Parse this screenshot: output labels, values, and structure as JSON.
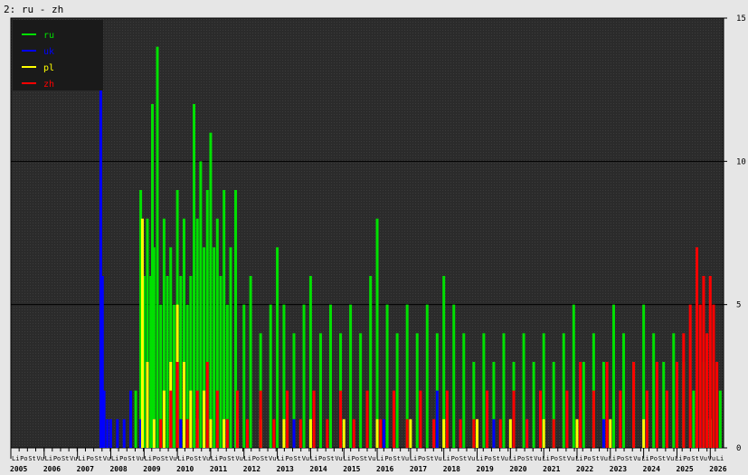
{
  "window_title": "2: ru - zh",
  "colors": {
    "background": "#e6e6e6",
    "plot_background": "#2d2d2d",
    "grid": "#000000",
    "ru": "#00e000",
    "uk": "#0000ff",
    "pl": "#ffff00",
    "zh": "#ff0000"
  },
  "chart_data": {
    "type": "bar",
    "title": "2: ru - zh",
    "xlabel": "",
    "ylabel": "",
    "ylim": [
      0,
      15
    ],
    "yticks": [
      0,
      5,
      10,
      15
    ],
    "grid": true,
    "legend_position": "top-left",
    "x_start": 2005.0,
    "x_end": 2026.4,
    "year_labels": [
      "2005",
      "2006",
      "2007",
      "2008",
      "2009",
      "2010",
      "2011",
      "2012",
      "2013",
      "2014",
      "2015",
      "2016",
      "2017",
      "2018",
      "2019",
      "2020",
      "2021",
      "2022",
      "2023",
      "2024",
      "2025",
      "2026"
    ],
    "month_tick_labels": [
      "Li",
      "Po",
      "St",
      "Vu",
      "Li",
      "Po",
      "St",
      "Vu",
      "Li",
      "Po",
      "St",
      "Vu",
      "Li",
      "Po",
      "St",
      "Vu",
      "Li",
      "Po",
      "St",
      "Vu",
      "Li",
      "Po",
      "St",
      "Vu",
      "Li",
      "Po",
      "St",
      "Vu",
      "Li",
      "Po",
      "St",
      "Vu",
      "Li",
      "Po",
      "St",
      "Vu",
      "Li",
      "Po",
      "St",
      "Vu",
      "Li",
      "Po",
      "St",
      "Vu",
      "Li",
      "Po",
      "St",
      "Vu",
      "Li",
      "Po",
      "St",
      "Vu",
      "Li",
      "Po",
      "St",
      "Vu",
      "Li",
      "Po",
      "St",
      "Vu",
      "Li",
      "Po",
      "St",
      "Vu",
      "Li",
      "Po",
      "St",
      "Vu",
      "Li",
      "Po",
      "St",
      "Vu",
      "Li",
      "Po",
      "St",
      "Vu",
      "Li",
      "Po",
      "St",
      "Vu",
      "Li",
      "Po",
      "St",
      "Vu",
      "Vu",
      "Li"
    ],
    "series": [
      {
        "name": "ru",
        "color": "#00e000",
        "points": [
          [
            2008.75,
            2
          ],
          [
            2008.9,
            9
          ],
          [
            2009.0,
            6
          ],
          [
            2009.1,
            8
          ],
          [
            2009.2,
            6
          ],
          [
            2009.25,
            12
          ],
          [
            2009.3,
            7
          ],
          [
            2009.4,
            14
          ],
          [
            2009.5,
            5
          ],
          [
            2009.6,
            8
          ],
          [
            2009.7,
            6
          ],
          [
            2009.8,
            7
          ],
          [
            2009.9,
            5
          ],
          [
            2010.0,
            9
          ],
          [
            2010.1,
            6
          ],
          [
            2010.2,
            8
          ],
          [
            2010.3,
            5
          ],
          [
            2010.4,
            6
          ],
          [
            2010.5,
            12
          ],
          [
            2010.6,
            8
          ],
          [
            2010.7,
            10
          ],
          [
            2010.8,
            7
          ],
          [
            2010.9,
            9
          ],
          [
            2011.0,
            11
          ],
          [
            2011.1,
            7
          ],
          [
            2011.2,
            8
          ],
          [
            2011.3,
            6
          ],
          [
            2011.4,
            9
          ],
          [
            2011.5,
            5
          ],
          [
            2011.6,
            7
          ],
          [
            2011.75,
            9
          ],
          [
            2012.0,
            5
          ],
          [
            2012.2,
            6
          ],
          [
            2012.5,
            4
          ],
          [
            2012.8,
            5
          ],
          [
            2013.0,
            7
          ],
          [
            2013.2,
            5
          ],
          [
            2013.5,
            4
          ],
          [
            2013.8,
            5
          ],
          [
            2014.0,
            6
          ],
          [
            2014.3,
            4
          ],
          [
            2014.6,
            5
          ],
          [
            2014.9,
            4
          ],
          [
            2015.2,
            5
          ],
          [
            2015.5,
            4
          ],
          [
            2015.8,
            6
          ],
          [
            2016.0,
            8
          ],
          [
            2016.3,
            5
          ],
          [
            2016.6,
            4
          ],
          [
            2016.9,
            5
          ],
          [
            2017.2,
            4
          ],
          [
            2017.5,
            5
          ],
          [
            2017.8,
            4
          ],
          [
            2018.0,
            6
          ],
          [
            2018.3,
            5
          ],
          [
            2018.6,
            4
          ],
          [
            2018.9,
            3
          ],
          [
            2019.2,
            4
          ],
          [
            2019.5,
            3
          ],
          [
            2019.8,
            4
          ],
          [
            2020.1,
            3
          ],
          [
            2020.4,
            4
          ],
          [
            2020.7,
            3
          ],
          [
            2021.0,
            4
          ],
          [
            2021.3,
            3
          ],
          [
            2021.6,
            4
          ],
          [
            2021.9,
            5
          ],
          [
            2022.2,
            3
          ],
          [
            2022.5,
            4
          ],
          [
            2022.8,
            3
          ],
          [
            2023.1,
            5
          ],
          [
            2023.4,
            4
          ],
          [
            2023.7,
            3
          ],
          [
            2024.0,
            5
          ],
          [
            2024.3,
            4
          ],
          [
            2024.6,
            3
          ],
          [
            2024.9,
            4
          ],
          [
            2025.2,
            3
          ],
          [
            2025.5,
            2
          ],
          [
            2025.8,
            3
          ],
          [
            2026.1,
            3
          ],
          [
            2026.3,
            2
          ]
        ]
      },
      {
        "name": "uk",
        "color": "#0000ff",
        "points": [
          [
            2007.7,
            13
          ],
          [
            2007.75,
            6
          ],
          [
            2007.8,
            2
          ],
          [
            2007.9,
            1
          ],
          [
            2008.0,
            1
          ],
          [
            2008.2,
            1
          ],
          [
            2008.4,
            1
          ],
          [
            2008.6,
            2
          ],
          [
            2008.9,
            1
          ],
          [
            2009.3,
            1
          ],
          [
            2010.1,
            1
          ],
          [
            2011.5,
            1
          ],
          [
            2013.5,
            1
          ],
          [
            2016.2,
            1
          ],
          [
            2017.8,
            2
          ],
          [
            2018.5,
            1
          ],
          [
            2019.5,
            1
          ],
          [
            2020.5,
            1
          ],
          [
            2022.8,
            1
          ],
          [
            2024.0,
            1
          ],
          [
            2025.7,
            1
          ]
        ]
      },
      {
        "name": "pl",
        "color": "#ffff00",
        "points": [
          [
            2008.95,
            8
          ],
          [
            2009.1,
            3
          ],
          [
            2009.3,
            1
          ],
          [
            2009.6,
            2
          ],
          [
            2009.8,
            3
          ],
          [
            2010.0,
            5
          ],
          [
            2010.2,
            3
          ],
          [
            2010.4,
            2
          ],
          [
            2010.6,
            1
          ],
          [
            2010.8,
            2
          ],
          [
            2011.0,
            1
          ],
          [
            2011.4,
            1
          ],
          [
            2011.8,
            1
          ],
          [
            2012.5,
            1
          ],
          [
            2013.2,
            1
          ],
          [
            2014.0,
            1
          ],
          [
            2015.0,
            1
          ],
          [
            2016.0,
            1
          ],
          [
            2017.0,
            1
          ],
          [
            2018.0,
            1
          ],
          [
            2019.0,
            1
          ],
          [
            2020.0,
            1
          ],
          [
            2021.0,
            1
          ],
          [
            2022.0,
            1
          ],
          [
            2023.0,
            1
          ],
          [
            2024.0,
            1
          ],
          [
            2025.0,
            1
          ],
          [
            2026.0,
            1
          ]
        ]
      },
      {
        "name": "zh",
        "color": "#ff0000",
        "points": [
          [
            2009.5,
            1
          ],
          [
            2009.8,
            2
          ],
          [
            2010.0,
            3
          ],
          [
            2010.3,
            1
          ],
          [
            2010.6,
            2
          ],
          [
            2010.9,
            3
          ],
          [
            2011.2,
            2
          ],
          [
            2011.5,
            1
          ],
          [
            2011.8,
            2
          ],
          [
            2012.1,
            1
          ],
          [
            2012.5,
            2
          ],
          [
            2012.9,
            1
          ],
          [
            2013.3,
            2
          ],
          [
            2013.7,
            1
          ],
          [
            2014.1,
            2
          ],
          [
            2014.5,
            1
          ],
          [
            2014.9,
            2
          ],
          [
            2015.3,
            1
          ],
          [
            2015.7,
            2
          ],
          [
            2016.1,
            1
          ],
          [
            2016.5,
            2
          ],
          [
            2016.9,
            1
          ],
          [
            2017.3,
            2
          ],
          [
            2017.7,
            1
          ],
          [
            2018.1,
            2
          ],
          [
            2018.5,
            1
          ],
          [
            2018.9,
            1
          ],
          [
            2019.3,
            2
          ],
          [
            2019.7,
            1
          ],
          [
            2020.1,
            2
          ],
          [
            2020.5,
            1
          ],
          [
            2020.9,
            2
          ],
          [
            2021.3,
            1
          ],
          [
            2021.7,
            2
          ],
          [
            2022.1,
            3
          ],
          [
            2022.5,
            2
          ],
          [
            2022.9,
            3
          ],
          [
            2023.3,
            2
          ],
          [
            2023.7,
            3
          ],
          [
            2024.1,
            2
          ],
          [
            2024.4,
            3
          ],
          [
            2024.7,
            2
          ],
          [
            2025.0,
            3
          ],
          [
            2025.2,
            4
          ],
          [
            2025.4,
            5
          ],
          [
            2025.6,
            7
          ],
          [
            2025.7,
            5
          ],
          [
            2025.8,
            6
          ],
          [
            2025.9,
            4
          ],
          [
            2026.0,
            6
          ],
          [
            2026.1,
            5
          ],
          [
            2026.2,
            3
          ]
        ]
      }
    ]
  }
}
